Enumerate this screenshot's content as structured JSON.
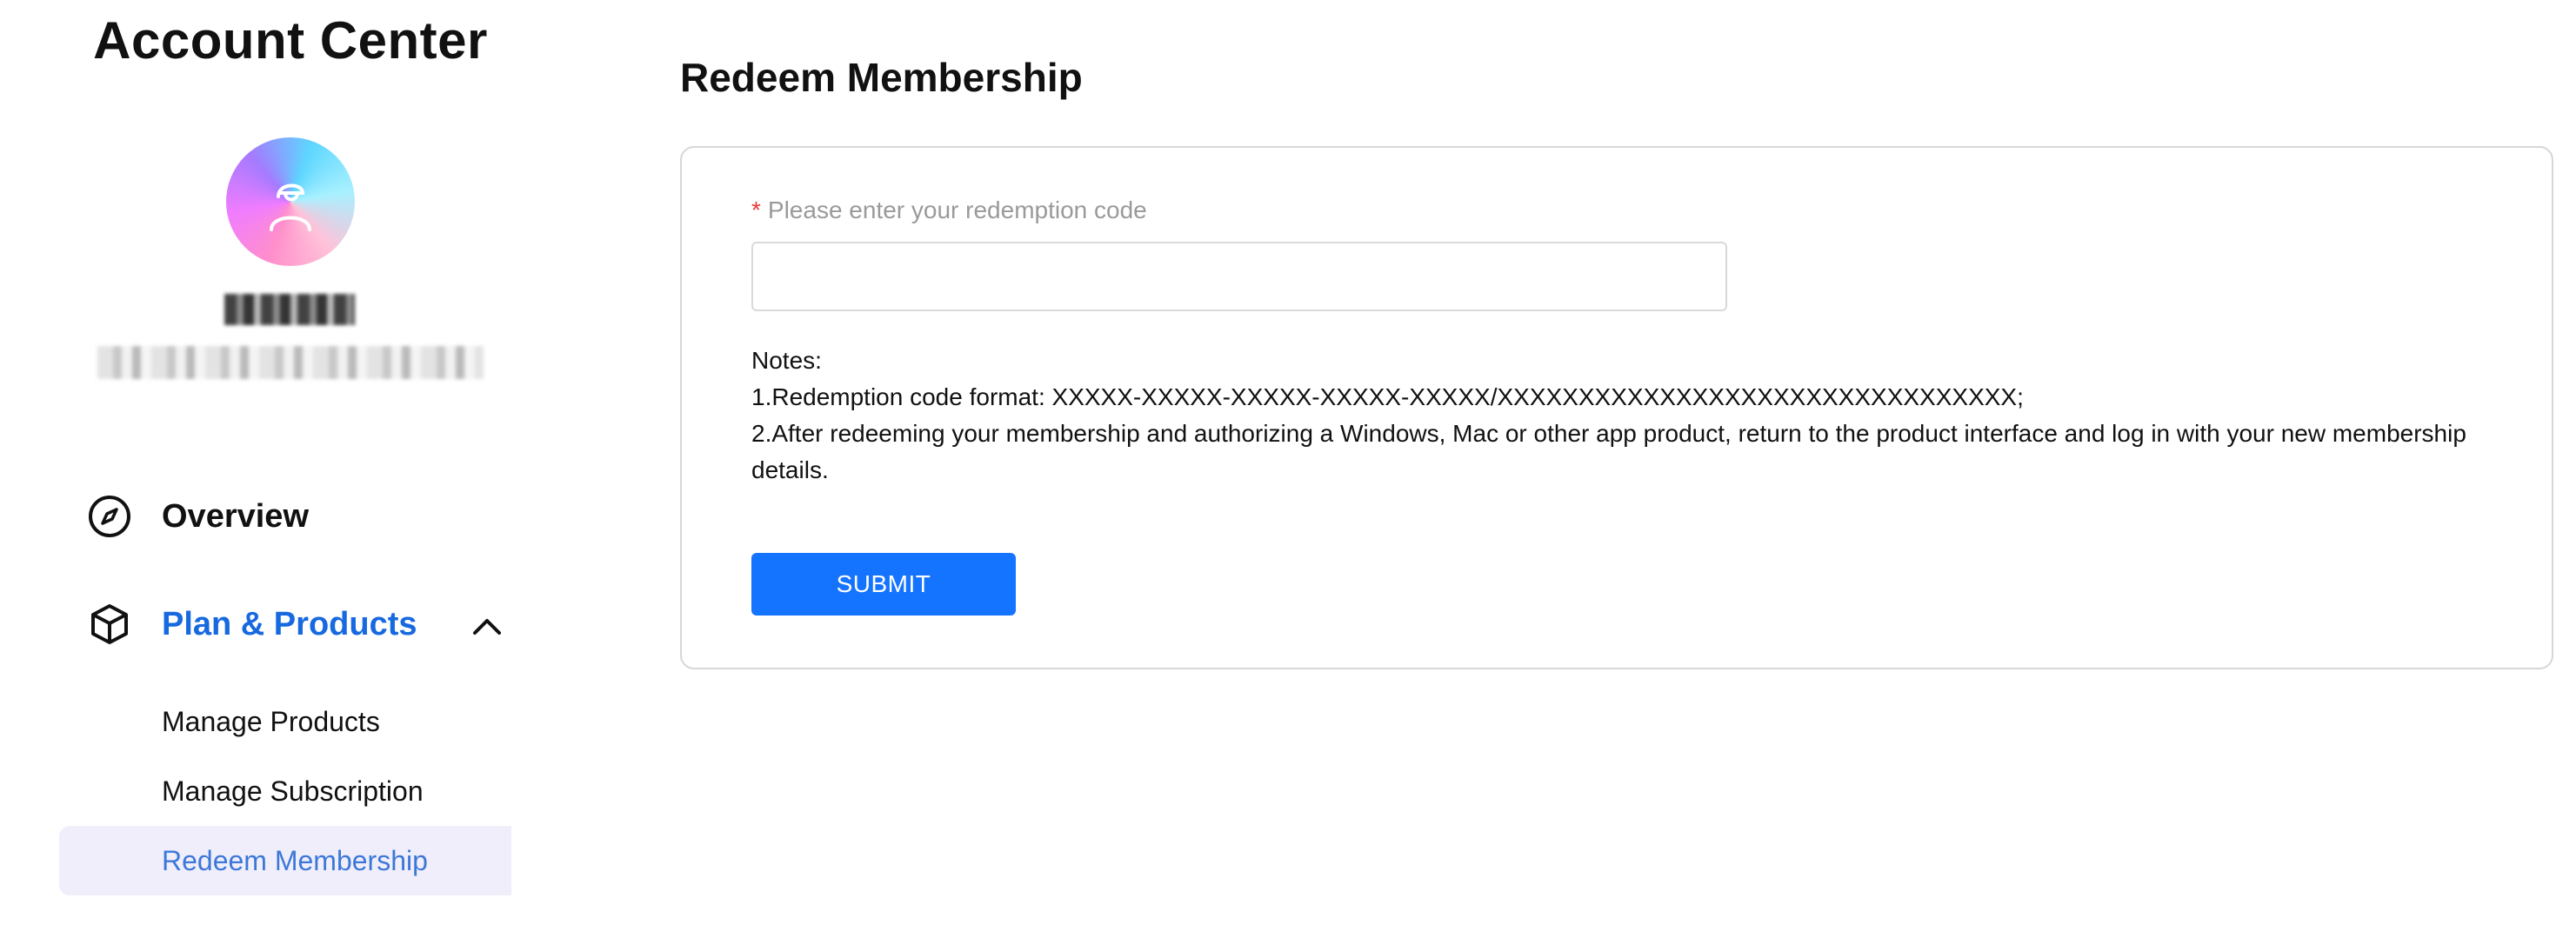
{
  "sidebar": {
    "title": "Account Center",
    "nav": [
      {
        "label": "Overview",
        "icon": "compass-icon"
      },
      {
        "label": "Plan & Products",
        "icon": "box-icon",
        "expanded": true
      }
    ],
    "sub_items": [
      {
        "label": "Manage Products",
        "active": false
      },
      {
        "label": "Manage Subscription",
        "active": false
      },
      {
        "label": "Redeem Membership",
        "active": true
      }
    ]
  },
  "main": {
    "title": "Redeem Membership",
    "form": {
      "label": "Please enter your redemption code",
      "required_mark": "*",
      "input_value": "",
      "notes_title": "Notes:",
      "note_1": "1.Redemption code format: XXXXX-XXXXX-XXXXX-XXXXX-XXXXX/XXXXXXXXXXXXXXXXXXXXXXXXXXXXXXXX;",
      "note_2": "2.After redeeming your membership and authorizing a Windows, Mac or other app product, return to the product interface and log in with your new membership details.",
      "submit_label": "SUBMIT"
    }
  },
  "colors": {
    "accent": "#1769e0",
    "button": "#1473ff",
    "active_bg": "#f1eefb",
    "required": "#e53935"
  }
}
